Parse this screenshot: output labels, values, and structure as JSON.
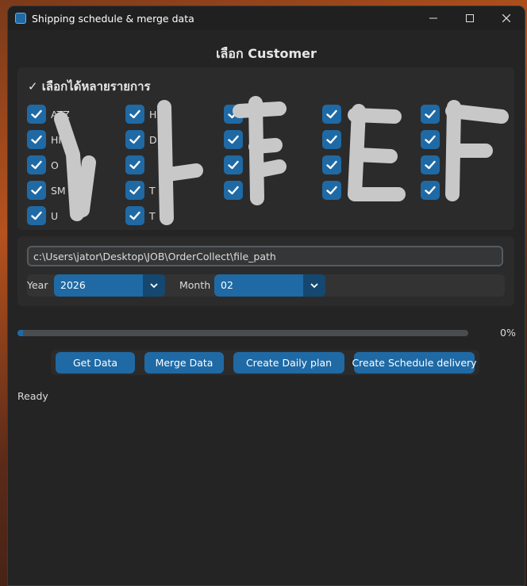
{
  "window": {
    "title": "Shipping schedule & merge data"
  },
  "heading": "เลือก Customer",
  "customers": {
    "multi_select_label": "✓ เลือกได้หลายรายการ",
    "columns": [
      {
        "items": [
          {
            "label": "ATZ",
            "checked": true
          },
          {
            "label": "HMC",
            "checked": true
          },
          {
            "label": "O",
            "checked": true
          },
          {
            "label": "SM",
            "checked": true
          },
          {
            "label": "U",
            "checked": true
          }
        ]
      },
      {
        "items": [
          {
            "label": "H",
            "checked": true
          },
          {
            "label": "D",
            "checked": true
          },
          {
            "label": "",
            "checked": true
          },
          {
            "label": "T",
            "checked": true
          },
          {
            "label": "T",
            "checked": true
          }
        ]
      },
      {
        "items": [
          {
            "label": "P",
            "checked": true
          },
          {
            "label": "",
            "checked": true
          },
          {
            "label": "",
            "checked": true
          },
          {
            "label": "",
            "checked": true
          }
        ]
      },
      {
        "items": [
          {
            "label": "",
            "checked": true
          },
          {
            "label": "",
            "checked": true
          },
          {
            "label": "",
            "checked": true
          },
          {
            "label": "",
            "checked": true
          }
        ]
      },
      {
        "items": [
          {
            "label": "",
            "checked": true
          },
          {
            "label": "",
            "checked": true
          },
          {
            "label": "",
            "checked": true
          },
          {
            "label": "",
            "checked": true
          }
        ]
      }
    ],
    "overlay_text": "ILLEF"
  },
  "path": {
    "value": "c:\\Users\\jator\\Desktop\\JOB\\OrderCollect\\file_path"
  },
  "year": {
    "label": "Year",
    "value": "2026"
  },
  "month": {
    "label": "Month",
    "value": "02"
  },
  "progress": {
    "fraction": 0.0,
    "text": "0%"
  },
  "buttons": {
    "get_data": "Get Data",
    "merge_data": "Merge Data",
    "create_daily_plan": "Create Daily plan",
    "create_schedule_delivery": "Create Schedule delivery"
  },
  "status": "Ready",
  "colors": {
    "accent": "#1f6aa5",
    "accent_dark": "#144870",
    "bg": "#242424",
    "frame": "#2b2b2b"
  }
}
